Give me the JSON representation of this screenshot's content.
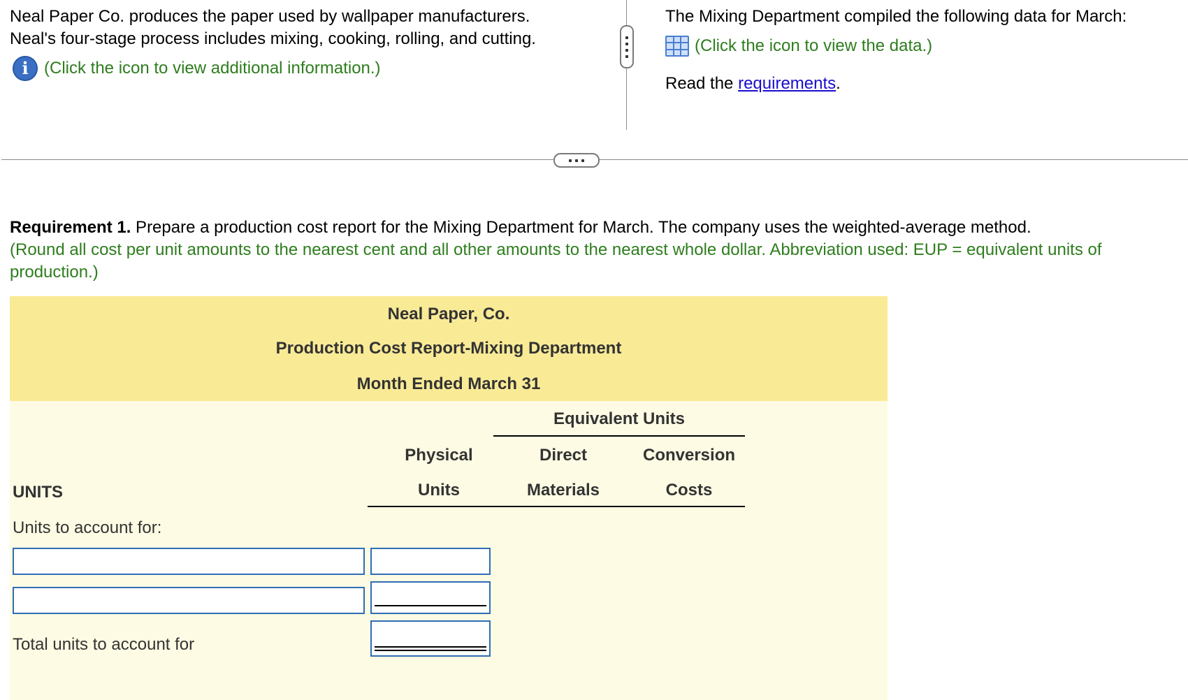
{
  "intro": {
    "line1": "Neal Paper Co. produces the paper used by wallpaper manufacturers.",
    "line2": "Neal's four-stage process includes mixing, cooking, rolling, and cutting.",
    "info_link": "(Click the icon to view additional information.)",
    "info_icon": "info-icon"
  },
  "right": {
    "line1": "The Mixing Department compiled the following data for March:",
    "data_link": "(Click the icon to view the data.)",
    "data_icon": "data-table-icon",
    "read_prefix": "Read the ",
    "requirements_link": "requirements",
    "read_suffix": "."
  },
  "requirement": {
    "label": "Requirement 1.",
    "text": " Prepare a production cost report for the Mixing Department for March. The company uses the weighted-average method.",
    "note": "(Round all cost per unit amounts to the nearest cent and all other amounts to the nearest whole dollar. Abbreviation used: EUP = equivalent units of production.)"
  },
  "report": {
    "company": "Neal Paper, Co.",
    "title": "Production Cost Report-Mixing Department",
    "period": "Month Ended March 31",
    "equiv_units": "Equivalent Units",
    "col_physical_1": "Physical",
    "col_physical_2": "Units",
    "col_dm_1": "Direct",
    "col_dm_2": "Materials",
    "col_cc_1": "Conversion",
    "col_cc_2": "Costs",
    "units_heading": "UNITS",
    "units_to_account": "Units to account for:",
    "total_units": "Total units to account for",
    "row1_label_value": "",
    "row1_units_value": "",
    "row2_label_value": "",
    "row2_units_value": "",
    "total_units_value": ""
  },
  "colors": {
    "header_band": "#f9ea96",
    "report_bg": "#fdfbe3",
    "green_text": "#2e7d1e",
    "link_blue": "#1a0dcc",
    "input_border": "#2f6db5"
  }
}
